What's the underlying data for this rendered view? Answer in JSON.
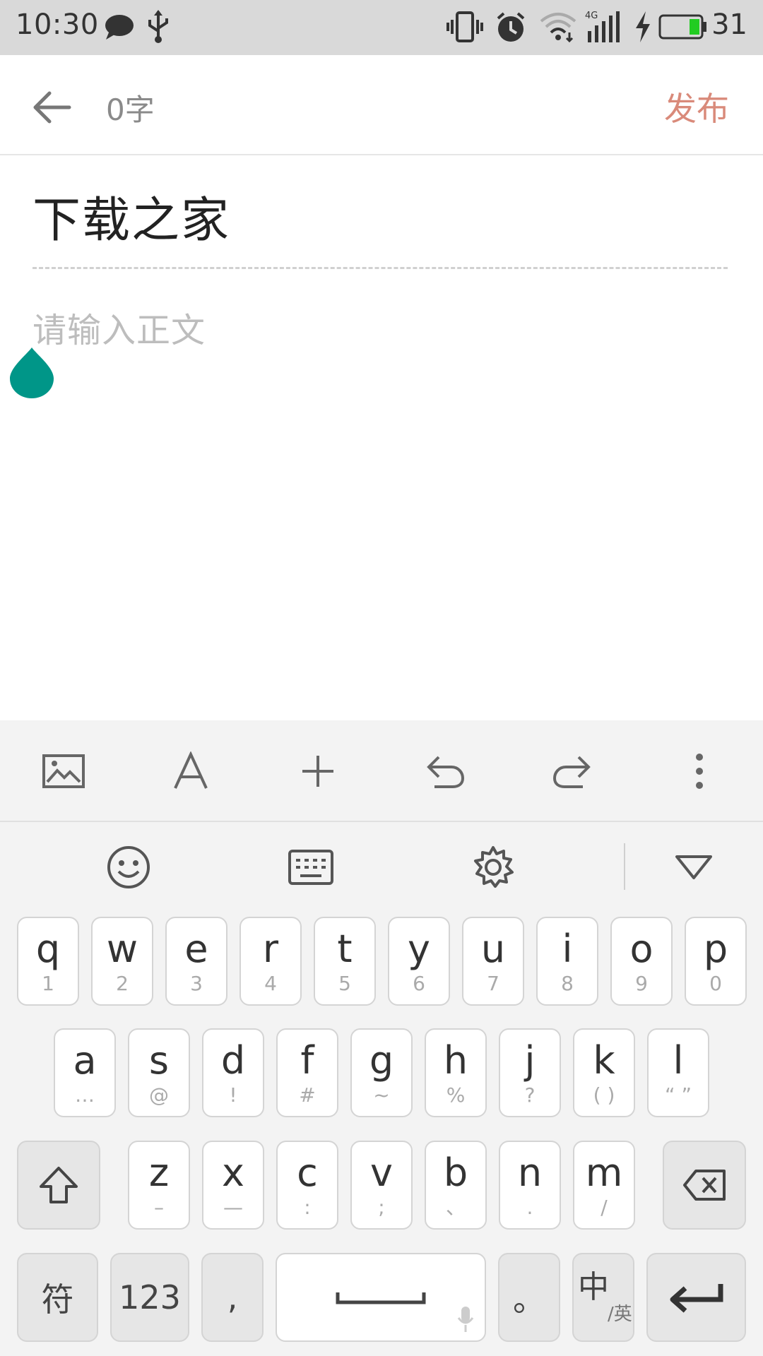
{
  "status_bar": {
    "time": "10:30",
    "battery_level": "31",
    "icons": [
      "chat-bubble-icon",
      "usb-icon",
      "vibrate-icon",
      "alarm-icon",
      "wifi-icon",
      "signal-4g-icon",
      "charging-icon",
      "battery-icon"
    ]
  },
  "header": {
    "word_count": "0字",
    "publish_label": "发布",
    "publish_color": "#d98a7a"
  },
  "editor": {
    "title": "下载之家",
    "body_placeholder": "请输入正文",
    "cursor_handle_color": "#009688"
  },
  "toolbar": {
    "icons": [
      "image-icon",
      "text-format-icon",
      "add-icon",
      "undo-icon",
      "redo-icon",
      "more-vert-icon"
    ]
  },
  "keyboard": {
    "top_icons": [
      "emoji-icon",
      "keyboard-icon",
      "settings-icon",
      "hide-keyboard-icon"
    ],
    "row1": [
      {
        "main": "q",
        "sub": "1"
      },
      {
        "main": "w",
        "sub": "2"
      },
      {
        "main": "e",
        "sub": "3"
      },
      {
        "main": "r",
        "sub": "4"
      },
      {
        "main": "t",
        "sub": "5"
      },
      {
        "main": "y",
        "sub": "6"
      },
      {
        "main": "u",
        "sub": "7"
      },
      {
        "main": "i",
        "sub": "8"
      },
      {
        "main": "o",
        "sub": "9"
      },
      {
        "main": "p",
        "sub": "0"
      }
    ],
    "row2": [
      {
        "main": "a",
        "sub": "…"
      },
      {
        "main": "s",
        "sub": "@"
      },
      {
        "main": "d",
        "sub": "!"
      },
      {
        "main": "f",
        "sub": "#"
      },
      {
        "main": "g",
        "sub": "~"
      },
      {
        "main": "h",
        "sub": "%"
      },
      {
        "main": "j",
        "sub": "?"
      },
      {
        "main": "k",
        "sub": "( )"
      },
      {
        "main": "l",
        "sub": "“ ”"
      }
    ],
    "row3": [
      {
        "main": "z",
        "sub": "–"
      },
      {
        "main": "x",
        "sub": "—"
      },
      {
        "main": "c",
        "sub": ":"
      },
      {
        "main": "v",
        "sub": ";"
      },
      {
        "main": "b",
        "sub": "、"
      },
      {
        "main": "n",
        "sub": "."
      },
      {
        "main": "m",
        "sub": "/"
      }
    ],
    "bottom": {
      "symbols": "符",
      "numbers": "123",
      "comma": ",",
      "period": "。",
      "lang_main": "中",
      "lang_sub": "/英"
    }
  }
}
